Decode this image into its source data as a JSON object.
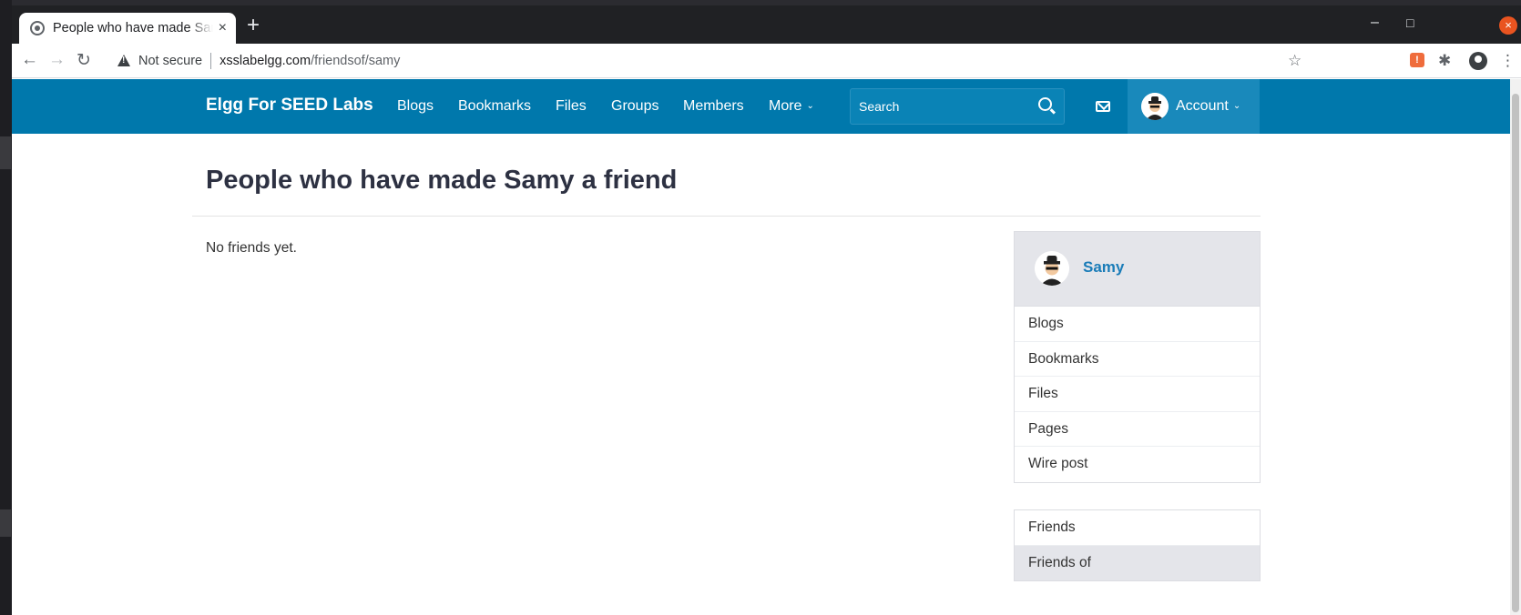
{
  "browser": {
    "tab_title": "People who have made Samy a friend",
    "new_tab": "+",
    "close_tab": "×",
    "security_label": "Not secure",
    "url_host": "xsslabelgg.com",
    "url_path": "/friendsof/samy",
    "window_controls": {
      "minimize": "–",
      "maximize": "□",
      "close": "×"
    },
    "icons": {
      "back": "←",
      "forward": "→",
      "reload": "↻",
      "bookmark": "☆",
      "extensions": "✱",
      "menu": "⋮"
    }
  },
  "site": {
    "brand": "Elgg For SEED Labs",
    "nav": [
      {
        "label": "Blogs"
      },
      {
        "label": "Bookmarks"
      },
      {
        "label": "Files"
      },
      {
        "label": "Groups"
      },
      {
        "label": "Members"
      },
      {
        "label": "More"
      }
    ],
    "search_placeholder": "Search",
    "account_label": "Account"
  },
  "page": {
    "title": "People who have made Samy a friend",
    "empty_message": "No friends yet."
  },
  "sidebar": {
    "owner_name": "Samy",
    "owner_menu": [
      {
        "label": "Blogs"
      },
      {
        "label": "Bookmarks"
      },
      {
        "label": "Files"
      },
      {
        "label": "Pages"
      },
      {
        "label": "Wire post"
      }
    ],
    "friends_menu": [
      {
        "label": "Friends",
        "active": false
      },
      {
        "label": "Friends of",
        "active": true
      }
    ]
  },
  "colors": {
    "topbar": "#0078ac",
    "account_bg": "#1989bb",
    "link": "#1a7cb8",
    "title": "#2d3142",
    "sidebar_active": "#e4e5ea"
  }
}
